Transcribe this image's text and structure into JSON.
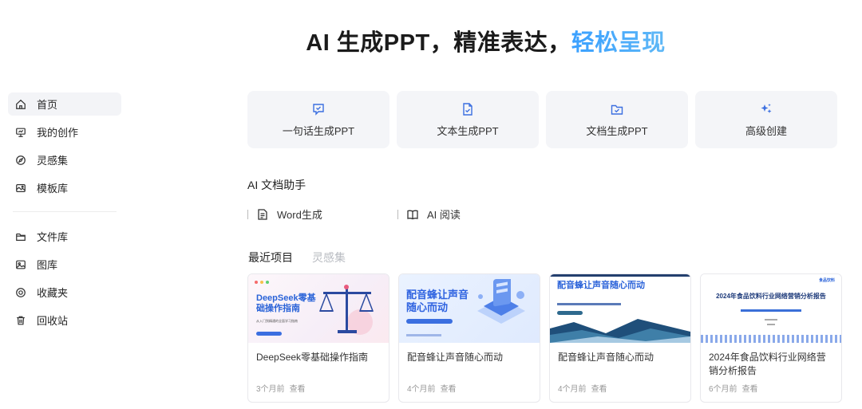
{
  "hero": {
    "main": "AI 生成PPT，精准表达，",
    "accent": "轻松呈现"
  },
  "sidebar": {
    "group1": [
      {
        "label": "首页",
        "icon": "home-icon",
        "active": true
      },
      {
        "label": "我的创作",
        "icon": "presentation-icon"
      },
      {
        "label": "灵感集",
        "icon": "compass-icon"
      },
      {
        "label": "模板库",
        "icon": "template-icon"
      }
    ],
    "group2": [
      {
        "label": "文件库",
        "icon": "folder-icon"
      },
      {
        "label": "图库",
        "icon": "image-icon"
      },
      {
        "label": "收藏夹",
        "icon": "favorite-icon"
      },
      {
        "label": "回收站",
        "icon": "trash-icon"
      }
    ]
  },
  "actions": [
    {
      "label": "一句话生成PPT",
      "icon": "chat-check-icon"
    },
    {
      "label": "文本生成PPT",
      "icon": "document-check-icon"
    },
    {
      "label": "文档生成PPT",
      "icon": "folder-check-icon"
    },
    {
      "label": "高级创建",
      "icon": "sparkle-icon"
    }
  ],
  "doc_helper": {
    "title": "AI 文档助手",
    "items": [
      {
        "label": "Word生成",
        "icon": "word-doc-icon"
      },
      {
        "label": "AI 阅读",
        "icon": "book-icon"
      }
    ]
  },
  "tabs": [
    {
      "label": "最近项目",
      "active": true
    },
    {
      "label": "灵感集",
      "active": false
    }
  ],
  "projects": [
    {
      "name": "DeepSeek零基础操作指南",
      "time": "3个月前",
      "action": "查看",
      "thumb_title": "DeepSeek零基础操作指南",
      "thumb_sub": "从入门到精通的全面学习指南"
    },
    {
      "name": "配音蜂让声音随心而动",
      "time": "4个月前",
      "action": "查看",
      "thumb_title": "配音蜂让声音随心而动"
    },
    {
      "name": "配音蜂让声音随心而动",
      "time": "4个月前",
      "action": "查看",
      "thumb_title": "配音蜂让声音随心而动"
    },
    {
      "name": "2024年食品饮料行业网络营销分析报告",
      "time": "6个月前",
      "action": "查看",
      "thumb_title": "2024年食品饮料行业网络营销分析报告",
      "thumb_logo": "食品饮料"
    }
  ],
  "colors": {
    "accent": "#3aa0ff",
    "brand_blue": "#2f63e0",
    "card_bg": "#f4f5f8"
  }
}
